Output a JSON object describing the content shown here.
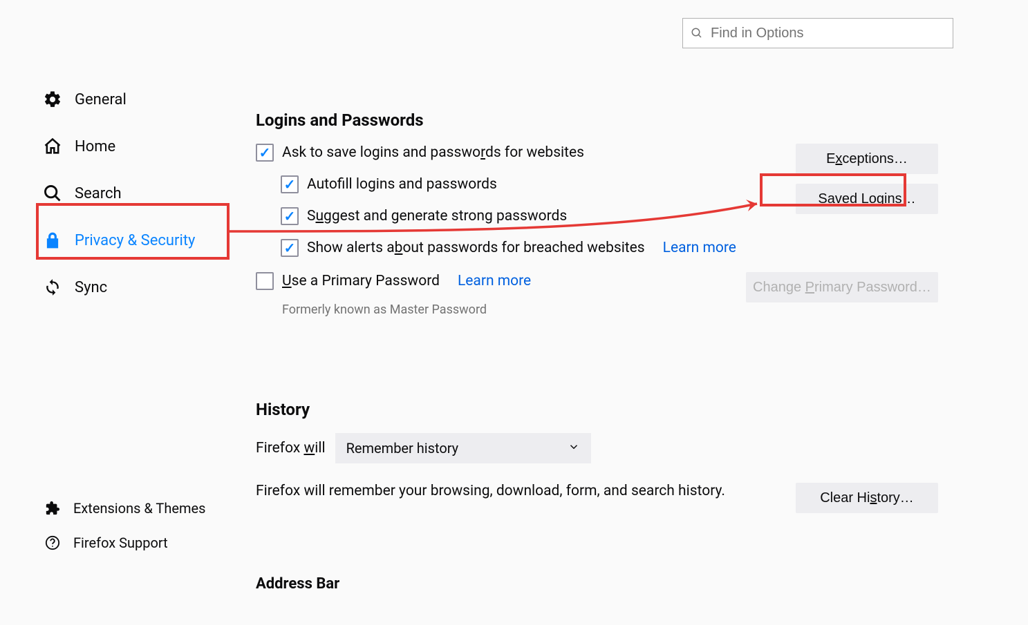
{
  "search": {
    "placeholder": "Find in Options"
  },
  "sidebar": {
    "items": [
      {
        "label": "General"
      },
      {
        "label": "Home"
      },
      {
        "label": "Search"
      },
      {
        "label": "Privacy & Security"
      },
      {
        "label": "Sync"
      }
    ],
    "bottom": [
      {
        "label": "Extensions & Themes"
      },
      {
        "label": "Firefox Support"
      }
    ]
  },
  "logins": {
    "title": "Logins and Passwords",
    "ask": "Ask to save logins and passwords for websites",
    "autofill": "Autofill logins and passwords",
    "suggest": "Suggest and generate strong passwords",
    "alerts": "Show alerts about passwords for breached websites",
    "learn_more": "Learn more",
    "primary": "Use a Primary Password",
    "primary_learn": "Learn more",
    "primary_hint": "Formerly known as Master Password",
    "btn_exceptions": "Exceptions…",
    "btn_saved": "Saved Logins…",
    "btn_change": "Change Primary Password…"
  },
  "history": {
    "title": "History",
    "firefox_will": "Firefox will",
    "dropdown": "Remember history",
    "desc": "Firefox will remember your browsing, download, form, and search history.",
    "btn_clear": "Clear History…"
  },
  "addressbar": {
    "title": "Address Bar"
  }
}
